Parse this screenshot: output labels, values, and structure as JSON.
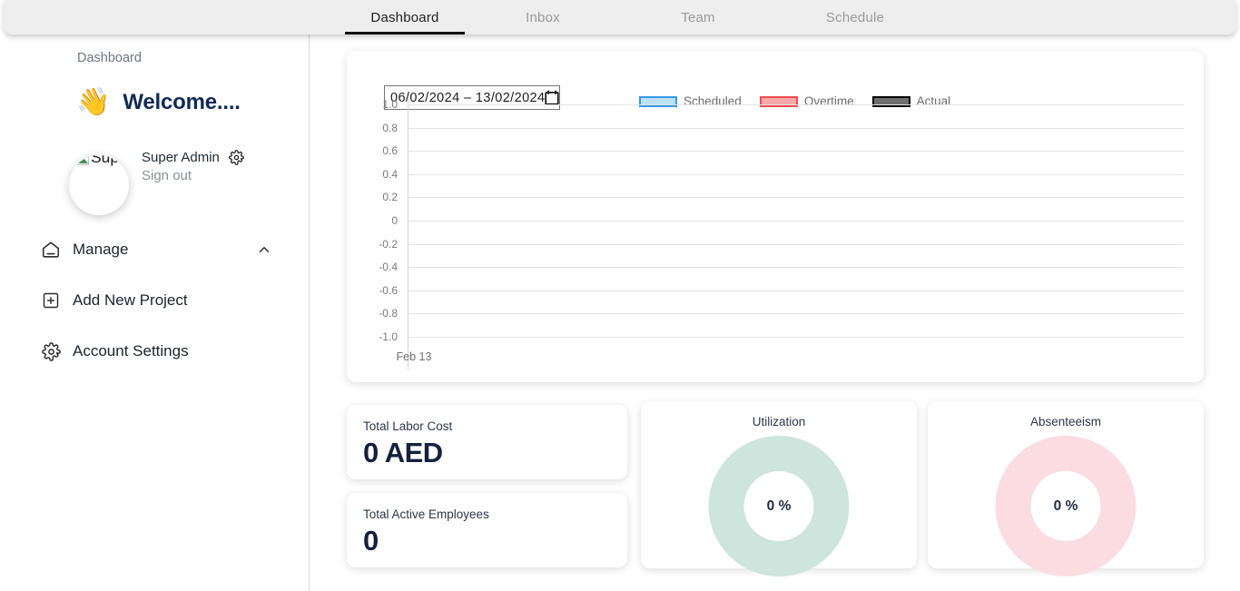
{
  "topnav": {
    "tabs": [
      {
        "label": "Dashboard",
        "active": true
      },
      {
        "label": "Inbox",
        "active": false
      },
      {
        "label": "Team",
        "active": false
      },
      {
        "label": "Schedule",
        "active": false
      }
    ]
  },
  "sidebar": {
    "breadcrumb": "Dashboard",
    "welcome": {
      "icon": "waving-hand-icon",
      "glyph": "👋",
      "text": "Welcome...."
    },
    "profile": {
      "avatar_alt": "Super Admin",
      "avatar_state": "broken-image",
      "name": "Super Admin",
      "settings_icon": "gear-icon",
      "signout": "Sign out"
    },
    "menu": [
      {
        "label": "Manage",
        "icon": "home-icon",
        "chevron": "chevron-up-icon"
      },
      {
        "label": "Add New Project",
        "icon": "plus-box-icon"
      },
      {
        "label": "Account Settings",
        "icon": "gear-icon"
      }
    ]
  },
  "main": {
    "daterange": {
      "value": "06/02/2024 – 13/02/2024",
      "icon": "calendar-icon"
    },
    "stats": [
      {
        "title": "Total Labor Cost",
        "value": "0 AED"
      },
      {
        "title": "Total Active Employees",
        "value": "0"
      }
    ],
    "donuts": [
      {
        "title": "Utilization",
        "value": "0 %",
        "color": "#cde5dc"
      },
      {
        "title": "Absenteeism",
        "value": "0 %",
        "color": "#fadce1"
      }
    ]
  },
  "chart_data": {
    "type": "bar",
    "title": "",
    "xlabel": "",
    "ylabel": "",
    "categories": [
      "Feb 13"
    ],
    "x": [
      "Feb 13"
    ],
    "series": [
      {
        "name": "Scheduled",
        "values": [
          0
        ],
        "fill": "#bde0f7",
        "stroke": "#3498e8"
      },
      {
        "name": "Overtime",
        "values": [
          0
        ],
        "fill": "#f7a8ab",
        "stroke": "#ee4b52"
      },
      {
        "name": "Actual",
        "values": [
          0
        ],
        "fill": "#6f6f6f",
        "stroke": "#000000"
      }
    ],
    "legend": [
      "Scheduled",
      "Overtime",
      "Actual"
    ],
    "legend_position": "top-center",
    "ylim": [
      -1.0,
      1.0
    ],
    "yticks": [
      "1.0",
      "0.8",
      "0.6",
      "0.4",
      "0.2",
      "0",
      "-0.2",
      "-0.4",
      "-0.6",
      "-0.8",
      "-1.0"
    ],
    "grid": true,
    "empty": true
  }
}
